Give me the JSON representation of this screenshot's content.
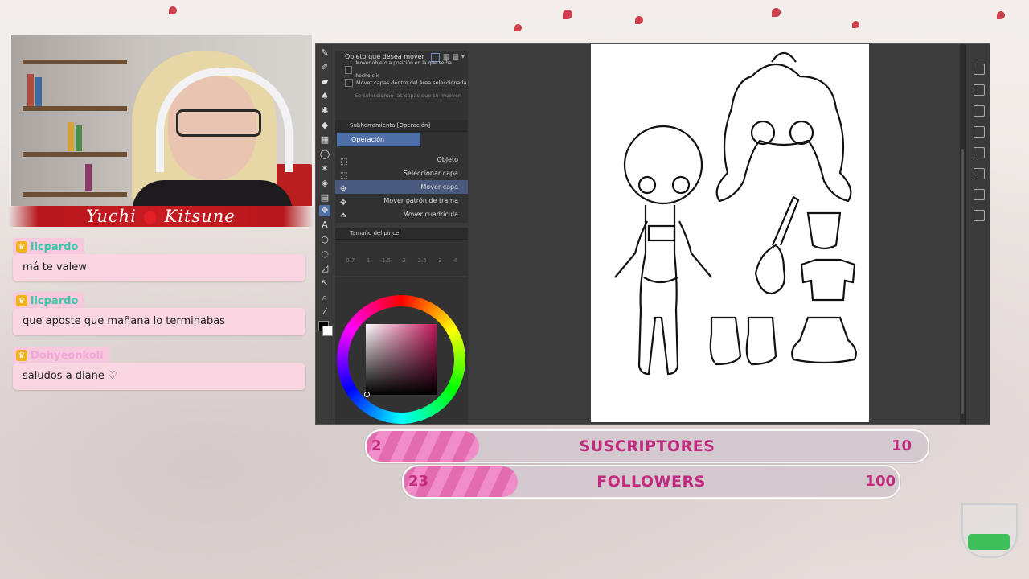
{
  "streamer": {
    "name": "Yuchi",
    "name_suffix": "Kitsune"
  },
  "chat": [
    {
      "user": "licpardo",
      "user_color": "#3cc8a8",
      "message": "má te valew"
    },
    {
      "user": "licpardo",
      "user_color": "#3cc8a8",
      "message": "que aposte que mañana lo terminabas"
    },
    {
      "user": "Dohyeonkoli",
      "user_color": "#f2a6d8",
      "message": "saludos a diane ♡"
    }
  ],
  "app": {
    "tool_options": {
      "label": "Objeto que desea mover",
      "option1": "Mover objeto a posición en la que se ha hecho clic",
      "option2": "Mover capas dentro del área seleccionada",
      "option3": "Se seleccionan las capas que se mueven"
    },
    "subtool_panel": {
      "title": "Subherramienta [Operación]",
      "tab": "Operación",
      "items": [
        "Objeto",
        "Seleccionar capa",
        "Mover capa",
        "Mover patrón de trama",
        "Mover cuadrícula"
      ],
      "selected_index": 2
    },
    "brush_panel": {
      "title": "Tamaño del pincel",
      "ticks": [
        "0.7",
        "1",
        "1.5",
        "2",
        "2.5",
        "3",
        "4"
      ]
    },
    "color_wheel": {
      "selected_hue": "#c2185b"
    }
  },
  "goals": {
    "subscribers": {
      "current": "2",
      "label": "SUSCRIPTORES",
      "target": "10",
      "fraction": 0.2
    },
    "followers": {
      "current": "23",
      "label": "FOLLOWERS",
      "target": "100",
      "fraction": 0.23
    }
  },
  "colors": {
    "accent": "#c12a7f",
    "banner": "#c81b22",
    "chat_bg": "#f9d6e2"
  }
}
